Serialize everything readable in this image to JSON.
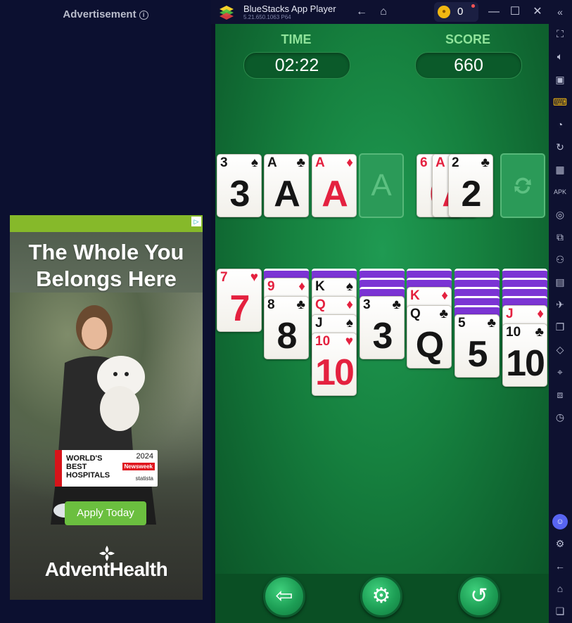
{
  "ad": {
    "label": "Advertisement",
    "info_icon": "info-icon",
    "choices_icon": "adchoices-icon",
    "headline_line1": "The Whole You",
    "headline_line2": "Belongs Here",
    "badge": {
      "title_line1": "WORLD'S",
      "title_line2": "BEST",
      "title_line3": "HOSPITALS",
      "year": "2024",
      "publisher": "Newsweek",
      "partner": "statista"
    },
    "cta": "Apply Today",
    "brand": "AdventHealth",
    "colors": {
      "top_bar": "#86b92a",
      "cta": "#6bbf3f"
    }
  },
  "window": {
    "app_title": "BlueStacks App Player",
    "version": "5.21.650.1063  P64",
    "coins": "0",
    "icons": [
      "back-arrow-icon",
      "home-icon",
      "coin-icon",
      "minimize-icon",
      "maximize-icon",
      "close-icon",
      "collapse-sidebar-icon"
    ]
  },
  "sidebar": {
    "icons": [
      "fullscreen-icon",
      "volume-icon",
      "screen-record-icon",
      "keyboard-icon",
      "macro-icon",
      "rotate-icon",
      "controller-icon",
      "apk-icon",
      "screenshot-icon",
      "resize-icon",
      "multi-instance-icon",
      "folder-icon",
      "airplane-icon",
      "copy-icon",
      "eraser-icon",
      "location-icon",
      "layers-icon",
      "speed-icon",
      "discord-icon",
      "settings-icon",
      "back-icon",
      "home-icon",
      "recent-apps-icon"
    ]
  },
  "game": {
    "time_label": "TIME",
    "time_value": "02:22",
    "score_label": "SCORE",
    "score_value": "660",
    "foundations": [
      {
        "rank": "3",
        "suit": "♠",
        "color": "black"
      },
      {
        "rank": "A",
        "suit": "♣",
        "color": "black"
      },
      {
        "rank": "A",
        "suit": "♦",
        "color": "red"
      },
      {
        "rank": "A",
        "suit": "",
        "color": "empty"
      }
    ],
    "waste": [
      {
        "rank": "6",
        "suit": "♥",
        "color": "red"
      },
      {
        "rank": "A",
        "suit": "♥",
        "color": "red"
      },
      {
        "rank": "2",
        "suit": "♣",
        "color": "black"
      }
    ],
    "stock_icon": "recycle-icon",
    "tableau": [
      {
        "hidden": 0,
        "cards": [
          {
            "rank": "7",
            "suit": "♥",
            "color": "red"
          }
        ]
      },
      {
        "hidden": 1,
        "cards": [
          {
            "rank": "9",
            "suit": "♦",
            "color": "red"
          },
          {
            "rank": "8",
            "suit": "♣",
            "color": "black"
          }
        ]
      },
      {
        "hidden": 1,
        "cards": [
          {
            "rank": "K",
            "suit": "♠",
            "color": "black"
          },
          {
            "rank": "Q",
            "suit": "♦",
            "color": "red"
          },
          {
            "rank": "J",
            "suit": "♠",
            "color": "black"
          },
          {
            "rank": "10",
            "suit": "♥",
            "color": "red"
          }
        ]
      },
      {
        "hidden": 3,
        "cards": [
          {
            "rank": "3",
            "suit": "♣",
            "color": "black"
          }
        ]
      },
      {
        "hidden": 2,
        "cards": [
          {
            "rank": "K",
            "suit": "♦",
            "color": "red"
          },
          {
            "rank": "Q",
            "suit": "♣",
            "color": "black"
          }
        ]
      },
      {
        "hidden": 5,
        "cards": [
          {
            "rank": "5",
            "suit": "♣",
            "color": "black"
          }
        ]
      },
      {
        "hidden": 4,
        "cards": [
          {
            "rank": "J",
            "suit": "♦",
            "color": "red"
          },
          {
            "rank": "10",
            "suit": "♣",
            "color": "black"
          }
        ]
      }
    ],
    "buttons": [
      "exit-icon",
      "settings-icon",
      "undo-icon"
    ],
    "colors": {
      "felt": "#16813f",
      "card_back": "#7b34d4",
      "red_suit": "#e4213f"
    }
  }
}
